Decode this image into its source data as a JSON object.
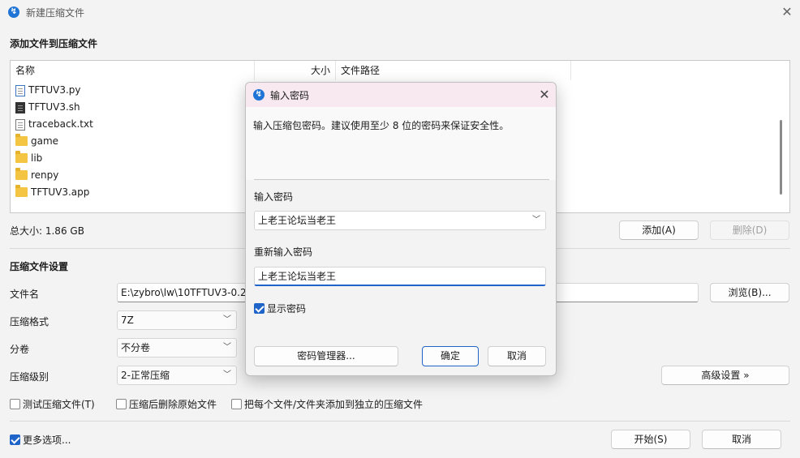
{
  "window": {
    "title": "新建压缩文件",
    "close": "✕"
  },
  "add_section": {
    "title": "添加文件到压缩文件"
  },
  "filelist": {
    "columns": {
      "name": "名称",
      "size": "大小",
      "path": "文件路径"
    },
    "rows": [
      {
        "name": "TFTUV3.py",
        "icon": "python-file-icon"
      },
      {
        "name": "TFTUV3.sh",
        "icon": "script-file-icon"
      },
      {
        "name": "traceback.txt",
        "icon": "text-file-icon"
      },
      {
        "name": "game",
        "icon": "folder-icon"
      },
      {
        "name": "lib",
        "icon": "folder-icon"
      },
      {
        "name": "renpy",
        "icon": "folder-icon"
      },
      {
        "name": "TFTUV3.app",
        "icon": "folder-icon"
      }
    ]
  },
  "total_size": "总大小: 1.86 GB",
  "buttons": {
    "add": "添加(A)",
    "delete": "删除(D)",
    "browse": "浏览(B)...",
    "advanced": "高级设置 »",
    "start": "开始(S)",
    "cancel": "取消"
  },
  "settings": {
    "title": "压缩文件设置",
    "filename_label": "文件名",
    "filename_value": "E:\\zybro\\lw\\10TFTUV3-0.25",
    "format_label": "压缩格式",
    "format_value": "7Z",
    "split_label": "分卷",
    "split_value": "不分卷",
    "level_label": "压缩级别",
    "level_value": "2-正常压缩"
  },
  "options": {
    "test": "测试压缩文件(T)",
    "delete_after": "压缩后删除原始文件",
    "separate": "把每个文件/文件夹添加到独立的压缩文件",
    "more": "更多选项..."
  },
  "dialog": {
    "title": "输入密码",
    "description": "输入压缩包密码。建议使用至少 8 位的密码来保证安全性。",
    "password_label": "输入密码",
    "password_value": "上老王论坛当老王",
    "reenter_label": "重新输入密码",
    "reenter_value": "上老王论坛当老王",
    "show_password": "显示密码",
    "manager_button": "密码管理器...",
    "ok_button": "确定",
    "cancel_button": "取消"
  },
  "colors": {
    "accent": "#1f64c8",
    "dialog_titlebar": "#f7e9ef"
  }
}
